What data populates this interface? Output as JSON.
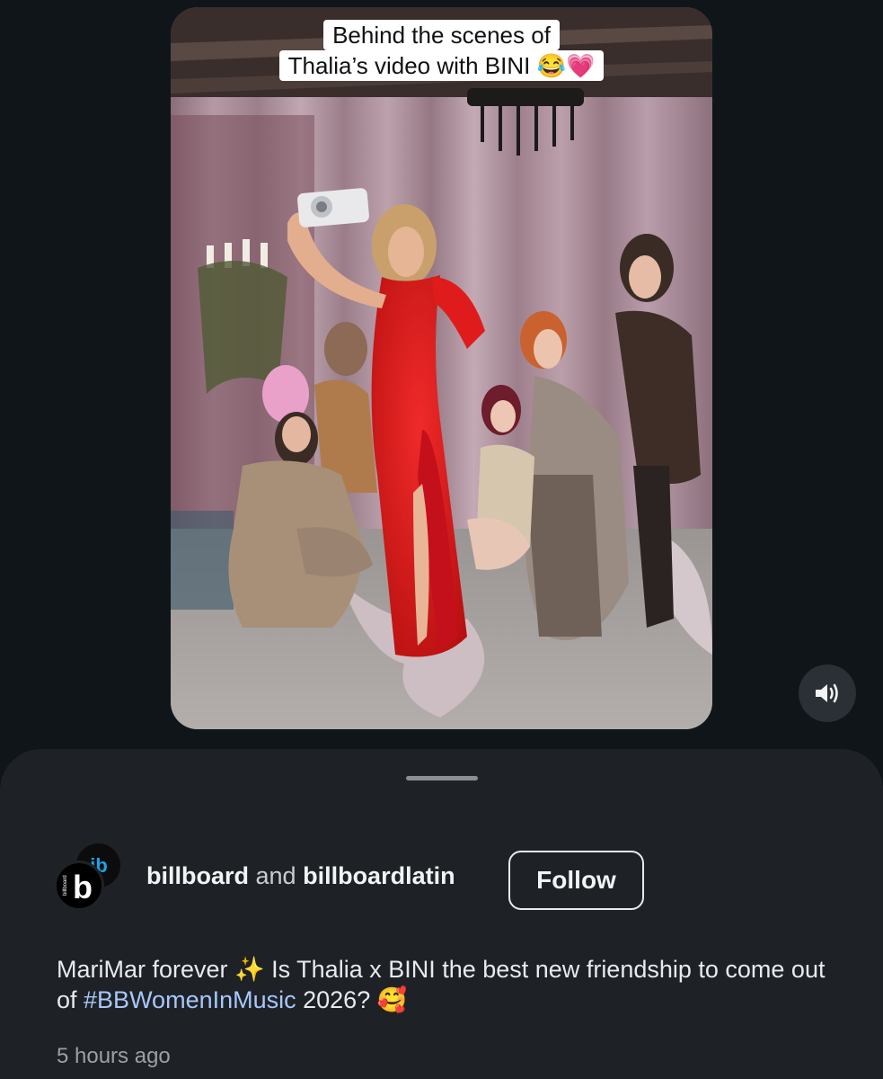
{
  "video": {
    "caption_line1": "Behind the scenes of",
    "caption_line2": "Thalia’s video with BINI 😂💗",
    "sound_icon": "volume-icon"
  },
  "post": {
    "author1": "billboard",
    "connector": "and",
    "author2": "billboardlatin",
    "follow_label": "Follow",
    "text_before_hashtag": "MariMar forever ✨ Is Thalia x BINI the best new friendship to come out of ",
    "hashtag": "#BBWomenInMusic",
    "text_after_hashtag": " 2026? 🥰",
    "timestamp": "5 hours ago"
  },
  "avatar": {
    "back_logo": "ib",
    "front_logo": "b",
    "front_vertical_text": "billboard"
  },
  "colors": {
    "background": "#10151a",
    "sheet": "#1e2226",
    "hashtag": "#a8c7fa",
    "dress": "#e01b1b",
    "billboard_blue": "#1aa3e8"
  }
}
